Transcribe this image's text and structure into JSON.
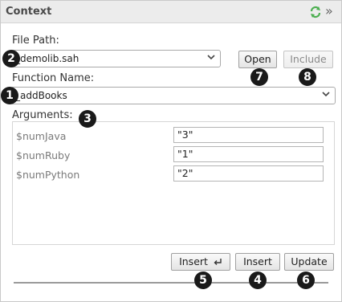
{
  "panel": {
    "title": "Context",
    "icons": {
      "refresh": "refresh-icon",
      "expand": "double-chevron-right-icon"
    }
  },
  "file_path": {
    "label": "File Path:",
    "value": "_demolib.sah",
    "open_label": "Open",
    "include_label": "Include"
  },
  "function": {
    "label": "Function Name:",
    "value": "_addBooks"
  },
  "arguments": {
    "label": "Arguments:",
    "items": [
      {
        "name": "$numJava",
        "value": "\"3\""
      },
      {
        "name": "$numRuby",
        "value": "\"1\""
      },
      {
        "name": "$numPython",
        "value": "\"2\""
      }
    ]
  },
  "actions": {
    "insert_enter_label": "Insert",
    "insert_label": "Insert",
    "update_label": "Update"
  },
  "callouts": [
    "1",
    "2",
    "3",
    "4",
    "5",
    "6",
    "7",
    "8"
  ],
  "colors": {
    "badge": "#1a1a1a",
    "refresh_icon": "#4caf50"
  }
}
